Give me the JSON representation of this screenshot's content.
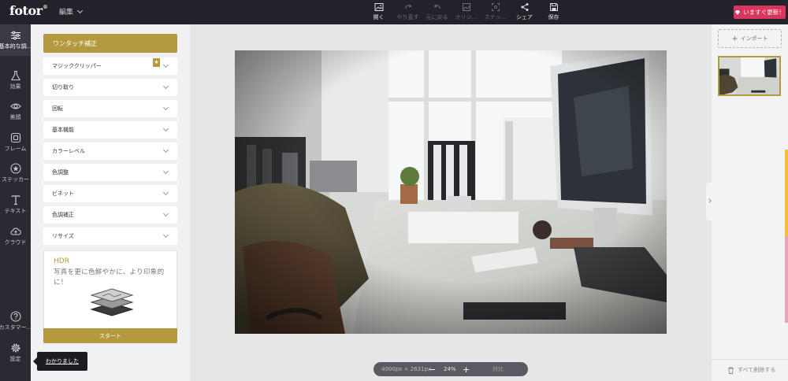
{
  "app": {
    "logo": "fotor",
    "logo_mark": "®",
    "menu_label": "編集"
  },
  "toolbar": [
    {
      "label": "開く",
      "icon": "image-icon",
      "enabled": true
    },
    {
      "label": "やり直す",
      "icon": "redo-icon",
      "enabled": false
    },
    {
      "label": "元に戻る",
      "icon": "undo-icon",
      "enabled": false
    },
    {
      "label": "オリジ...",
      "icon": "compare-icon",
      "enabled": false
    },
    {
      "label": "スナッ...",
      "icon": "snapshot-icon",
      "enabled": false
    },
    {
      "label": "シェア",
      "icon": "share-icon",
      "enabled": true
    },
    {
      "label": "保存",
      "icon": "save-icon",
      "enabled": true
    }
  ],
  "upgrade": {
    "label": "いますぐ更新！",
    "icon": "gem-icon",
    "color": "#d9355e"
  },
  "rail": [
    {
      "label": "基本的な調...",
      "icon": "sliders-icon",
      "active": true
    },
    {
      "label": "効果",
      "icon": "flask-icon",
      "active": false
    },
    {
      "label": "美顔",
      "icon": "eye-icon",
      "active": false
    },
    {
      "label": "フレーム",
      "icon": "frame-icon",
      "active": false
    },
    {
      "label": "ステッカー",
      "icon": "star-icon",
      "active": false
    },
    {
      "label": "テキスト",
      "icon": "text-icon",
      "active": false
    },
    {
      "label": "クラウド",
      "icon": "cloud-icon",
      "active": false
    }
  ],
  "rail_bottom": [
    {
      "label": "カスタマー...",
      "icon": "help-icon"
    },
    {
      "label": "設定",
      "icon": "settings-icon"
    }
  ],
  "panel": {
    "one_touch": "ワンタッチ補正",
    "sections": [
      "マジッククリッパー",
      "切り取り",
      "回転",
      "基本機能",
      "カラーレベル",
      "色調整",
      "ビネット",
      "色調補正",
      "リサイズ"
    ],
    "hdr": {
      "title": "HDR",
      "description": "写真を更に色鮮やかに、より印象的に！",
      "start": "スタート"
    },
    "tooltip": "わかりました"
  },
  "canvas": {
    "image_size": "4000px × 2631px",
    "zoom": "24%",
    "minus": "−",
    "plus": "+",
    "fit": "対比"
  },
  "right_panel": {
    "import_icon": "+",
    "import": "インポート",
    "delete_all": "すべて削除する"
  },
  "colors": {
    "accent": "#b5993f",
    "topbar": "#22222b",
    "rail": "#2a2a33"
  }
}
